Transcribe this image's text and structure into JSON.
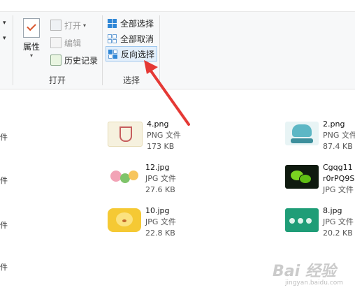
{
  "ribbon": {
    "open_group": {
      "properties_label": "属性",
      "open_label": "打开",
      "edit_label": "编辑",
      "history_label": "历史记录",
      "group_label": "打开"
    },
    "select_group": {
      "select_all_label": "全部选择",
      "select_none_label": "全部取消",
      "invert_label": "反向选择",
      "group_label": "选择"
    }
  },
  "files": {
    "left_edge_fragments": [
      "件",
      "件",
      "件",
      "件"
    ],
    "items": [
      {
        "name": "4.png",
        "type": "PNG 文件",
        "size": "173 KB",
        "thumb": "image-thumb-frame"
      },
      {
        "name": "2.png",
        "type": "PNG 文件",
        "size": "87.4 KB",
        "thumb": "image-thumb-shark"
      },
      {
        "name": "12.jpg",
        "type": "JPG 文件",
        "size": "27.6 KB",
        "thumb": "image-thumb-cartoon"
      },
      {
        "name": "Cgqg11",
        "name_line2": "r0rPQ9S",
        "type": "JPG 文件",
        "thumb": "image-thumb-wechat"
      },
      {
        "name": "10.jpg",
        "type": "JPG 文件",
        "size": "22.8 KB",
        "thumb": "image-thumb-bear"
      },
      {
        "name": "8.jpg",
        "type": "JPG 文件",
        "size": "20.2 KB",
        "thumb": "image-thumb-green"
      }
    ]
  },
  "watermark": {
    "text": "Bai 经验",
    "sub": "jingyan.baidu.com"
  },
  "colors": {
    "accent": "#2f86d6",
    "arrow": "#e53935",
    "ribbon_bg": "#f7f8f9"
  }
}
